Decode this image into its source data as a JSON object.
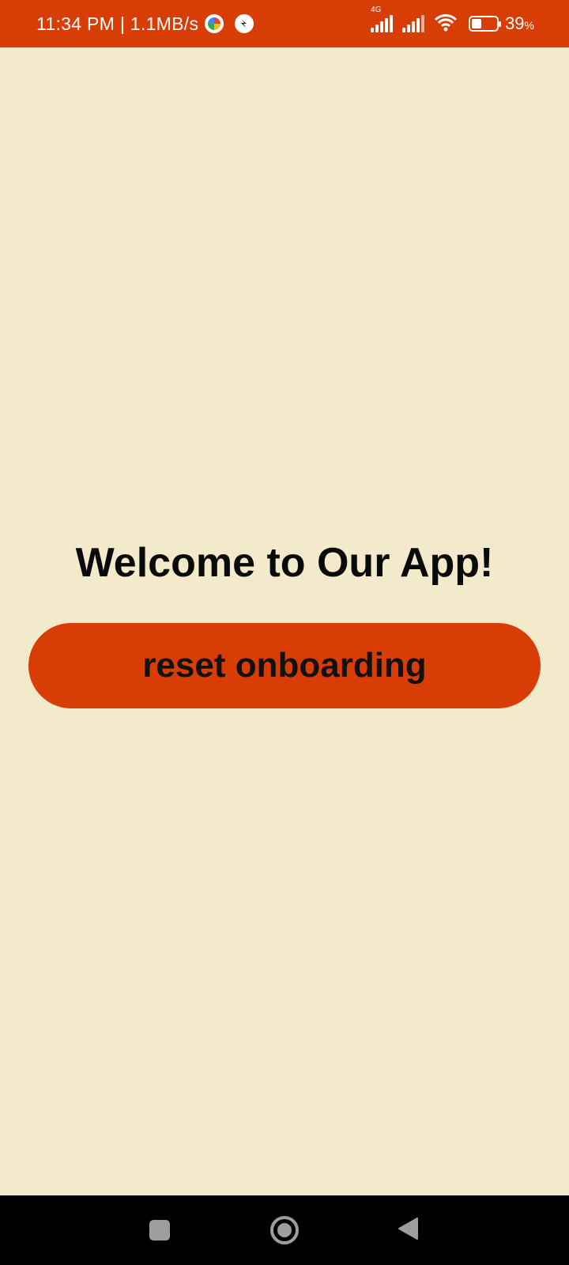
{
  "status_bar": {
    "time_speed": "11:34 PM | 1.1MB/s",
    "network_label": "4G",
    "battery_percent": "39",
    "battery_unit": "%",
    "battery_level": 0.39,
    "icons": [
      "pinwheel-icon",
      "app-notification-icon",
      "signal-icon",
      "signal-2-icon",
      "wifi-icon",
      "battery-icon"
    ]
  },
  "main": {
    "title": "Welcome to Our App!",
    "reset_button_label": "reset onboarding"
  },
  "nav_bar": {
    "icons": [
      "recents-icon",
      "home-icon",
      "back-icon"
    ]
  },
  "colors": {
    "accent": "#D83D06",
    "background": "#F3EACB",
    "text": "#0a0a0a",
    "nav_bar": "#000000"
  }
}
